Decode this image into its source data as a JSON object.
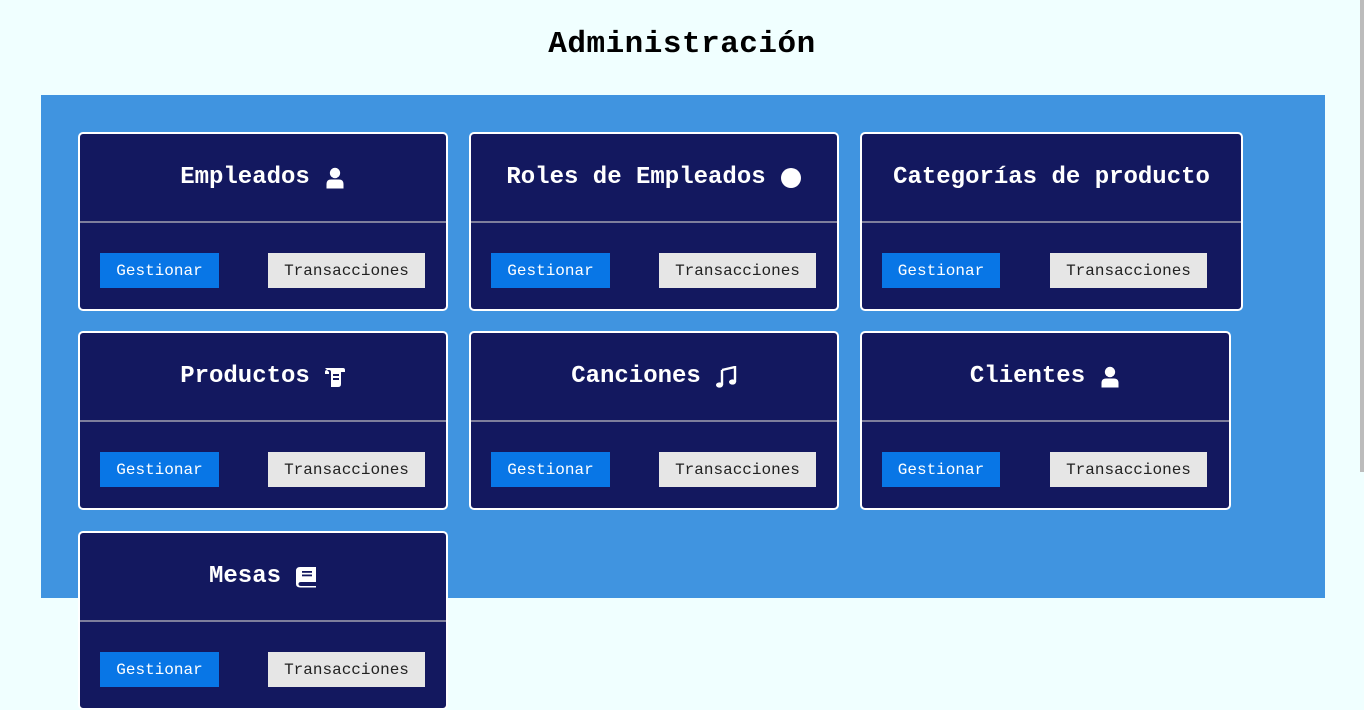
{
  "page": {
    "title": "Administración"
  },
  "colors": {
    "background": "#f0ffff",
    "panel": "#4094e0",
    "card": "#13185f",
    "primary_button": "#0876e6",
    "secondary_button": "#e6e6e6"
  },
  "cards": [
    {
      "title": "Empleados",
      "icon": "user-icon",
      "primary_label": "Gestionar",
      "secondary_label": "Transacciones"
    },
    {
      "title": "Roles de Empleados",
      "icon": "circle-icon",
      "primary_label": "Gestionar",
      "secondary_label": "Transacciones"
    },
    {
      "title": "Categorías de producto",
      "icon": "",
      "primary_label": "Gestionar",
      "secondary_label": "Transacciones"
    },
    {
      "title": "Productos",
      "icon": "scroll-icon",
      "primary_label": "Gestionar",
      "secondary_label": "Transacciones"
    },
    {
      "title": "Canciones",
      "icon": "music-icon",
      "primary_label": "Gestionar",
      "secondary_label": "Transacciones"
    },
    {
      "title": "Clientes",
      "icon": "user-icon",
      "primary_label": "Gestionar",
      "secondary_label": "Transacciones"
    },
    {
      "title": "Mesas",
      "icon": "book-icon",
      "primary_label": "Gestionar",
      "secondary_label": "Transacciones"
    }
  ]
}
